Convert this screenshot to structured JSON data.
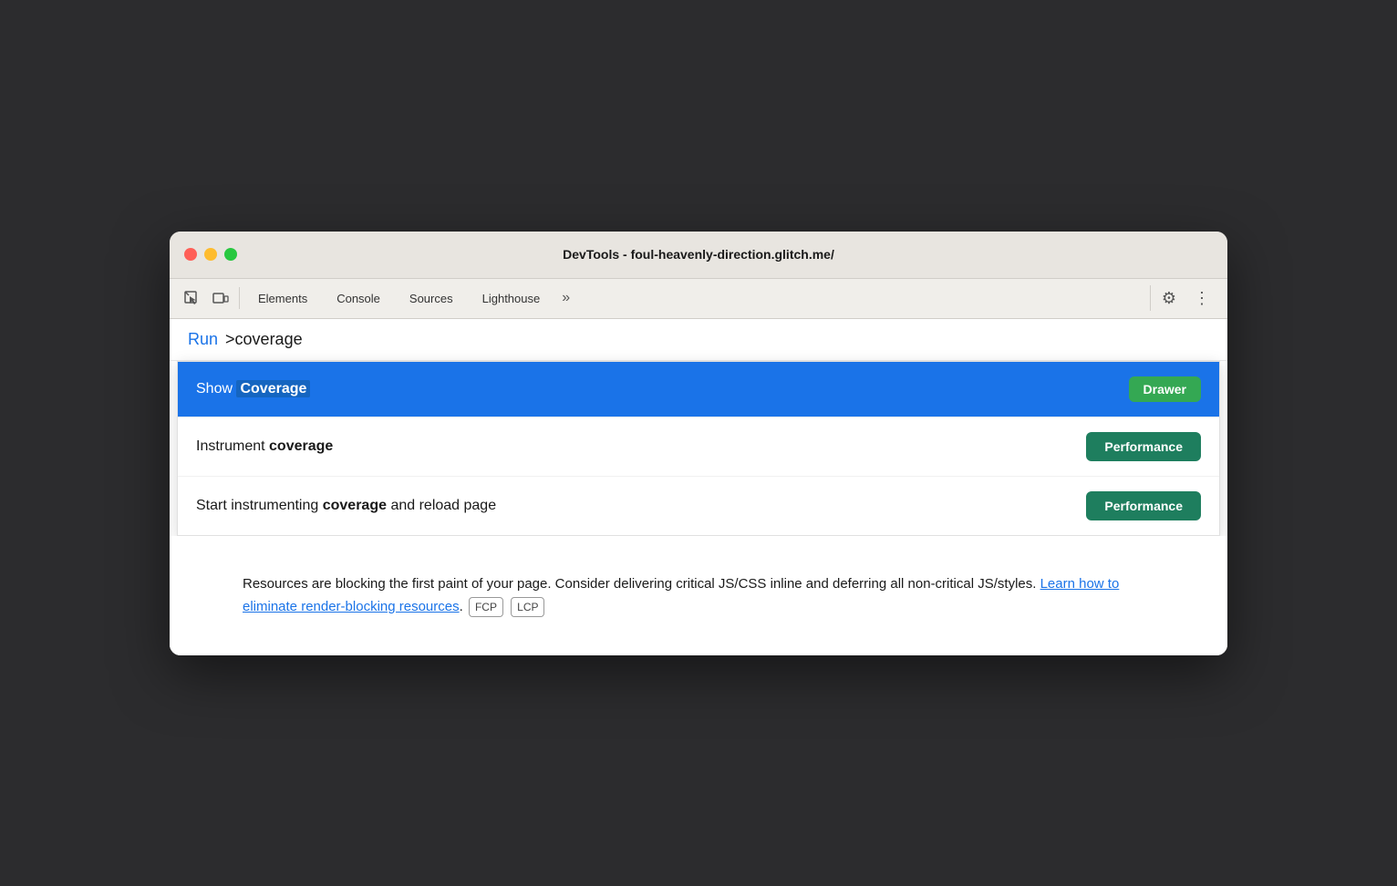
{
  "window": {
    "title": "DevTools - foul-heavenly-direction.glitch.me/"
  },
  "toolbar": {
    "tabs": [
      {
        "label": "Elements"
      },
      {
        "label": "Console"
      },
      {
        "label": "Sources"
      },
      {
        "label": "Lighthouse"
      }
    ],
    "more_label": "»",
    "gear_icon": "⚙",
    "more_icon": "⋮"
  },
  "command_bar": {
    "run_label": "Run",
    "input_value": ">coverage"
  },
  "dropdown": {
    "items": [
      {
        "text_before": "Show ",
        "text_bold": "Coverage",
        "text_after": "",
        "badge": "Drawer",
        "badge_type": "drawer",
        "highlighted": true
      },
      {
        "text_before": "Instrument ",
        "text_bold": "coverage",
        "text_after": "",
        "badge": "Performance",
        "badge_type": "performance",
        "highlighted": false
      },
      {
        "text_before": "Start instrumenting ",
        "text_bold": "coverage",
        "text_after": " and reload page",
        "badge": "Performance",
        "badge_type": "performance",
        "highlighted": false
      }
    ]
  },
  "main_content": {
    "paragraph": "Resources are blocking the first paint of your page. Consider delivering critical JS/CSS inline and deferring all non-critical JS/styles.",
    "link_text": "Learn how to eliminate render-blocking resources",
    "link_suffix": ".",
    "tags": [
      "FCP",
      "LCP"
    ]
  }
}
